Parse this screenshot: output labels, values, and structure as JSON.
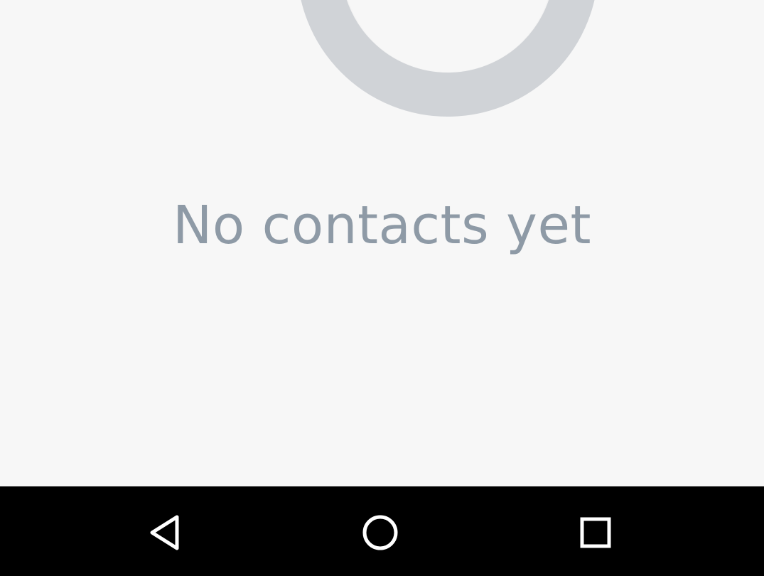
{
  "empty_state": {
    "icon": "empty-contacts-ring-icon",
    "message": "No contacts yet"
  },
  "navigation_bar": {
    "buttons": [
      {
        "name": "back",
        "icon": "back-triangle-icon"
      },
      {
        "name": "home",
        "icon": "home-circle-icon"
      },
      {
        "name": "recents",
        "icon": "recents-square-icon"
      }
    ]
  },
  "colors": {
    "background": "#f7f7f7",
    "ring": "#d0d3d7",
    "message_text": "#8e9aa6",
    "navbar": "#000000",
    "nav_icon": "#ffffff"
  }
}
